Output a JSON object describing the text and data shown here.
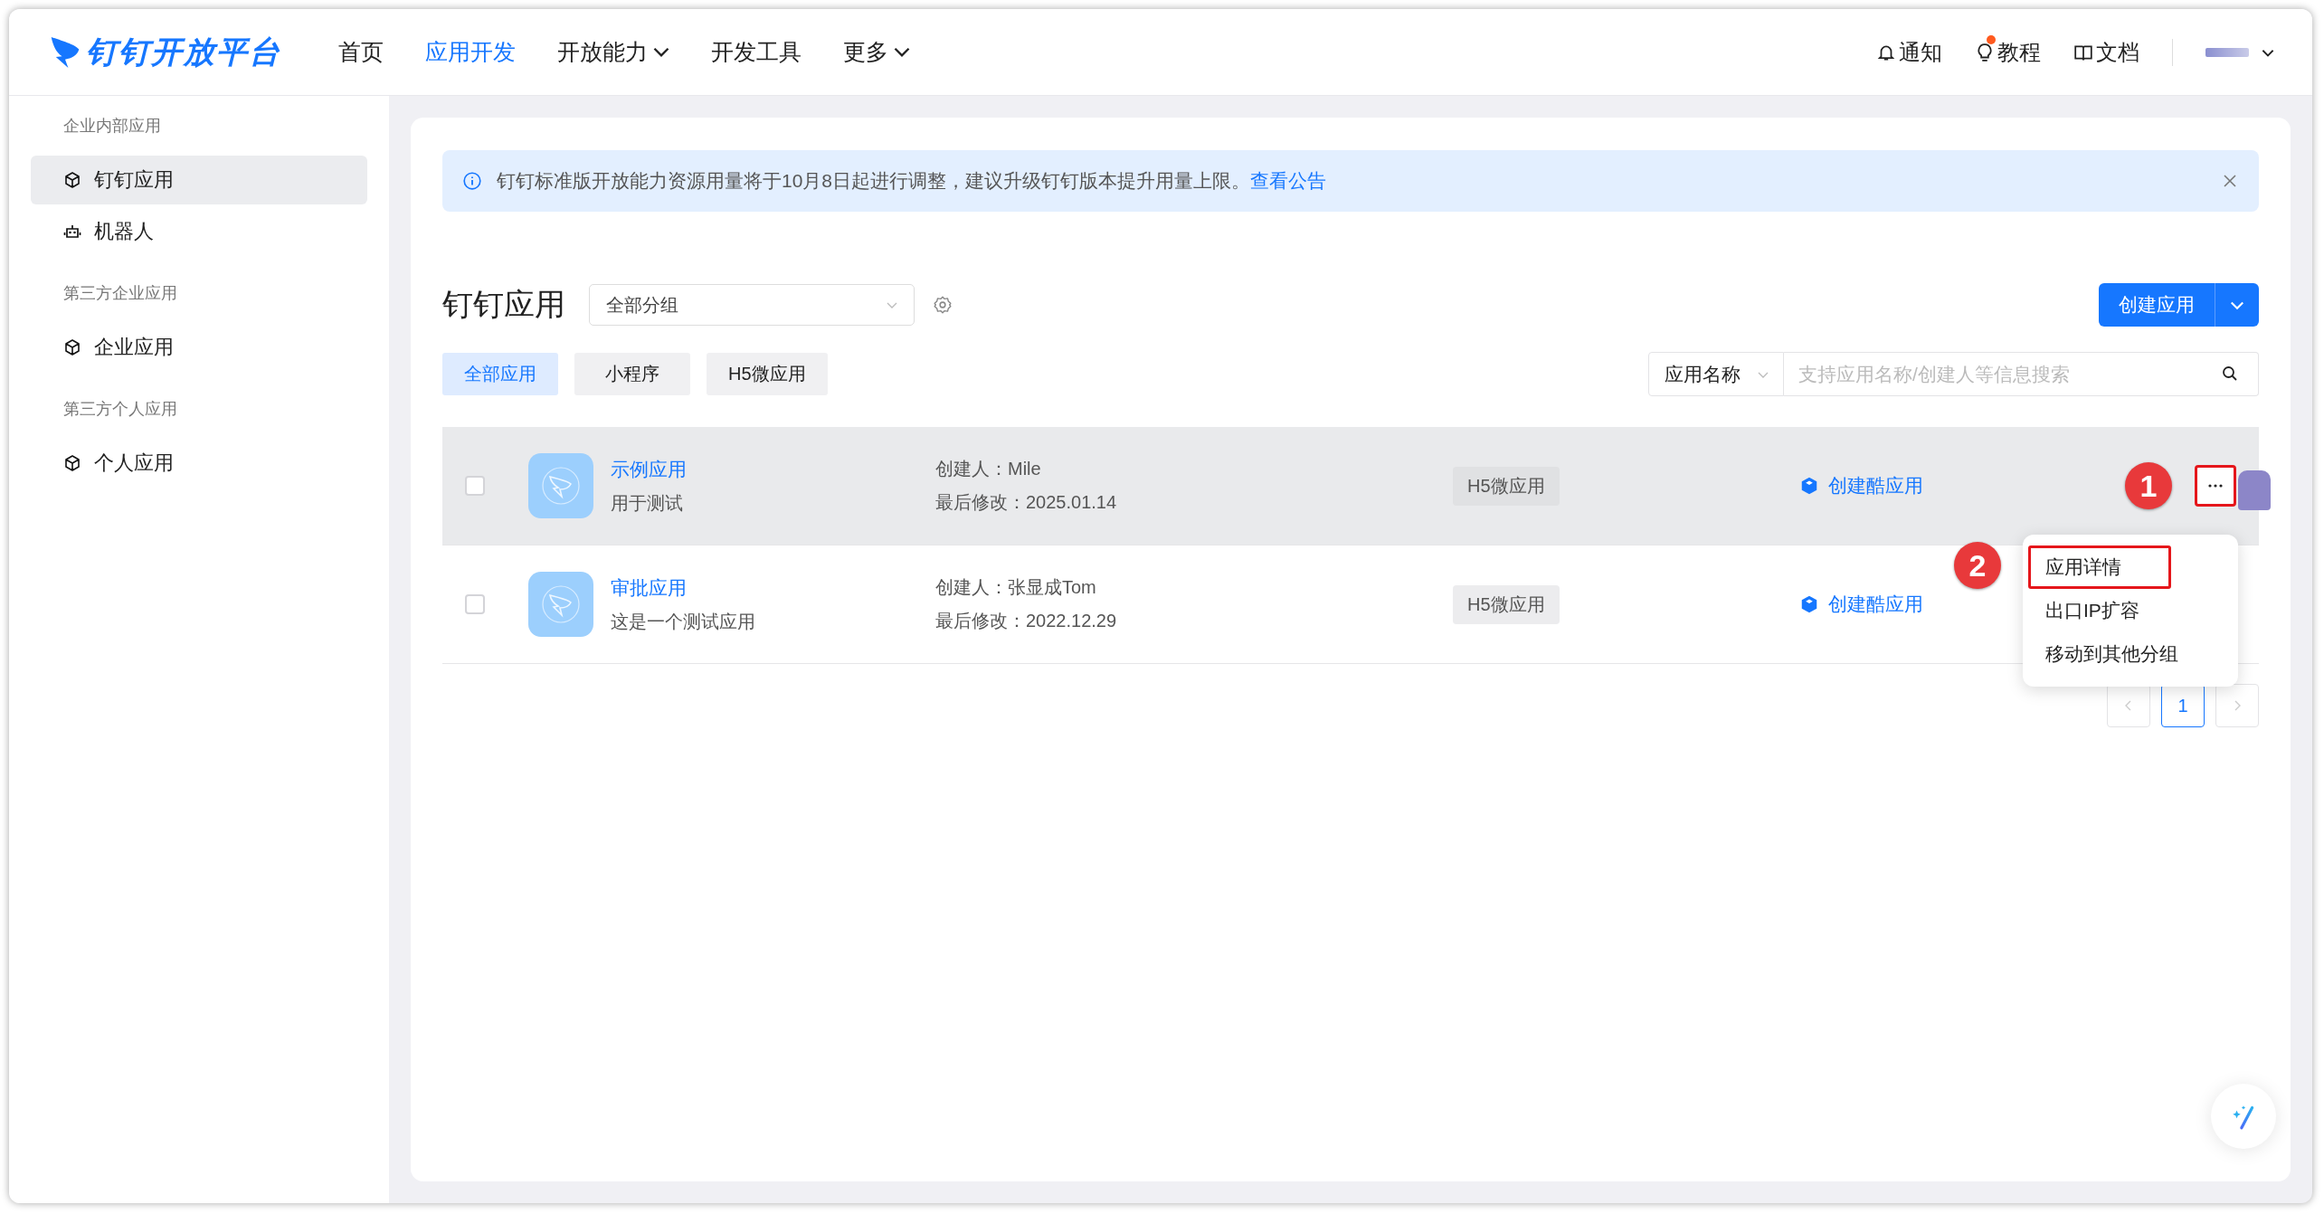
{
  "header": {
    "brand": "钉钉开放平台",
    "nav": [
      {
        "label": "首页",
        "selected": false,
        "dropdown": false
      },
      {
        "label": "应用开发",
        "selected": true,
        "dropdown": false
      },
      {
        "label": "开放能力",
        "selected": false,
        "dropdown": true
      },
      {
        "label": "开发工具",
        "selected": false,
        "dropdown": false
      },
      {
        "label": "更多",
        "selected": false,
        "dropdown": true
      }
    ],
    "tools": [
      {
        "kind": "bell",
        "label": "通知",
        "badge": false
      },
      {
        "kind": "bulb",
        "label": "教程",
        "badge": true
      },
      {
        "kind": "book",
        "label": "文档",
        "badge": false
      }
    ]
  },
  "sidebar": {
    "sections": [
      {
        "title": "企业内部应用",
        "items": [
          {
            "kind": "cube",
            "label": "钉钉应用",
            "selected": true
          },
          {
            "kind": "robot",
            "label": "机器人",
            "selected": false
          }
        ]
      },
      {
        "title": "第三方企业应用",
        "items": [
          {
            "kind": "cube",
            "label": "企业应用",
            "selected": false
          }
        ]
      },
      {
        "title": "第三方个人应用",
        "items": [
          {
            "kind": "cube",
            "label": "个人应用",
            "selected": false
          }
        ]
      }
    ]
  },
  "banner": {
    "text": "钉钉标准版开放能力资源用量将于10月8日起进行调整，建议升级钉钉版本提升用量上限。",
    "link": "查看公告"
  },
  "page": {
    "title": "钉钉应用",
    "group_select": "全部分组",
    "create_button": "创建应用"
  },
  "filters": [
    {
      "label": "全部应用",
      "selected": true
    },
    {
      "label": "小程序",
      "selected": false
    },
    {
      "label": "H5微应用",
      "selected": false
    }
  ],
  "search": {
    "field": "应用名称",
    "placeholder": "支持应用名称/创建人等信息搜索"
  },
  "apps": [
    {
      "name": "示例应用",
      "description": "用于测试",
      "creator": "创建人：Mile",
      "modified": "最后修改：2025.01.14",
      "type": "H5微应用",
      "action": "创建酷应用",
      "checked": false,
      "hovered": true,
      "outlined": true,
      "annotation": "1"
    },
    {
      "name": "审批应用",
      "description": "这是一个测试应用",
      "creator": "创建人：张显成Tom",
      "modified": "最后修改：2022.12.29",
      "type": "H5微应用",
      "action": "创建酷应用",
      "checked": false,
      "hovered": false
    }
  ],
  "menu": {
    "items": [
      {
        "label": "应用详情",
        "outlined": true,
        "annotation": "2"
      },
      {
        "label": "出口IP扩容",
        "outlined": false
      },
      {
        "label": "移动到其他分组",
        "outlined": false
      }
    ]
  },
  "pagination": {
    "pages": [
      {
        "label": "1",
        "selected": true
      }
    ]
  }
}
